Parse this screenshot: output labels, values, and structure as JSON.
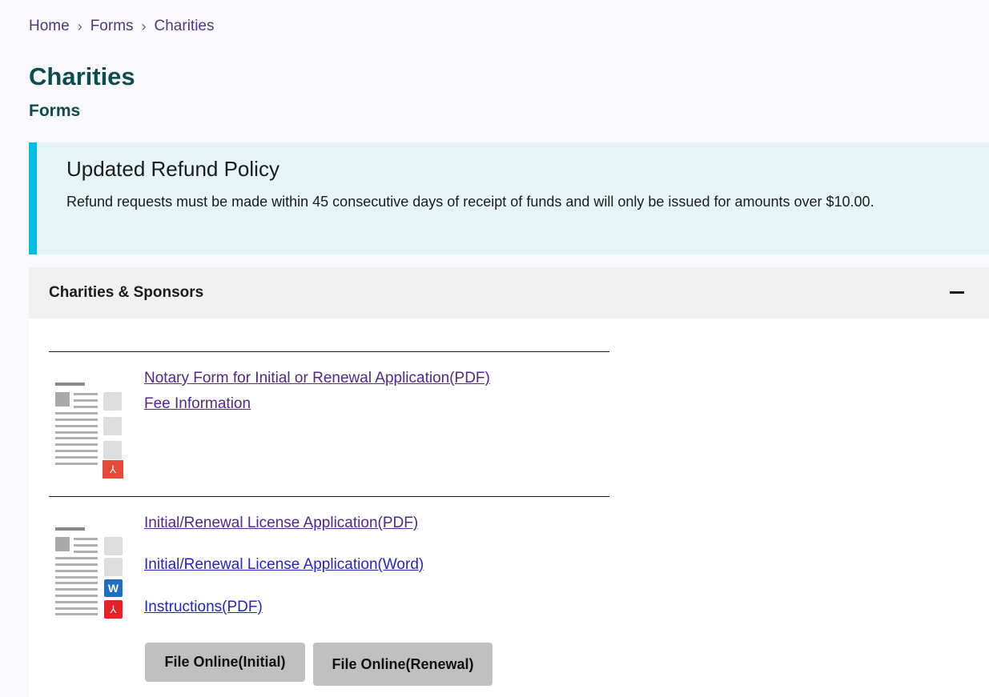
{
  "breadcrumb": [
    {
      "label": "Home"
    },
    {
      "label": "Forms"
    },
    {
      "label": "Charities"
    }
  ],
  "breadcrumb_separator": "›",
  "page": {
    "title": "Charities",
    "subtitle": "Forms"
  },
  "alert": {
    "title": "Updated Refund Policy",
    "body": "Refund requests must be made within 45 consecutive days of receipt of funds and will only be issued for amounts over $10.00.",
    "accent_color": "#00bde3"
  },
  "accordion": {
    "title": "Charities & Sponsors",
    "toggle_icon": "minus-icon",
    "expanded": true,
    "items": [
      {
        "thumbnail": "document-pdf-icon",
        "links": [
          {
            "label": "Notary Form for Initial or Renewal Application(PDF)",
            "visited": true
          },
          {
            "label": "Fee Information",
            "visited": true
          }
        ]
      },
      {
        "thumbnail": "document-word-pdf-icon",
        "links": [
          {
            "label": "Initial/Renewal License Application(PDF)",
            "visited": true
          },
          {
            "label": "Initial/Renewal License Application(Word)",
            "visited": false
          },
          {
            "label": "Instructions(PDF)",
            "visited": false
          }
        ],
        "buttons": [
          {
            "label": "File Online(Initial)"
          },
          {
            "label": "File Online(Renewal)"
          }
        ]
      }
    ]
  },
  "colors": {
    "heading": "#0b4d4f",
    "link_visited": "#54278f",
    "link_unvisited": "#2424c9",
    "breadcrumb_link": "#4f3a7f"
  }
}
